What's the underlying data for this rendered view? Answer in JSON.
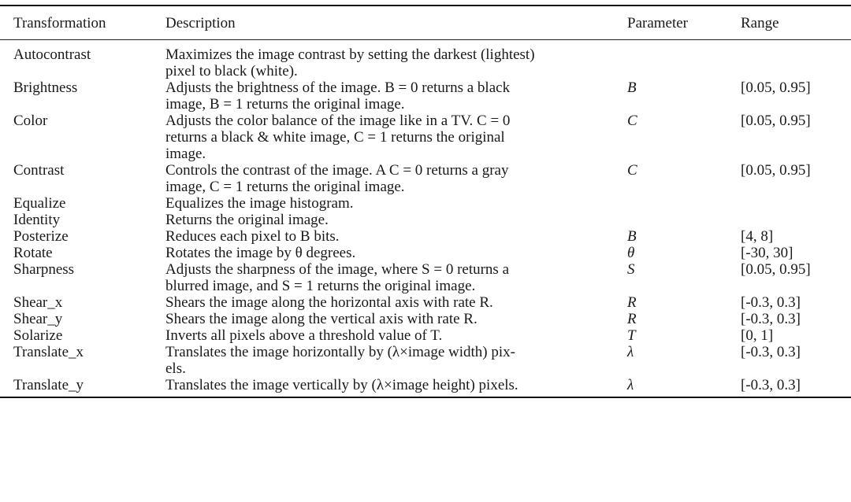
{
  "table": {
    "headers": {
      "transformation": "Transformation",
      "description": "Description",
      "parameter": "Parameter",
      "range": "Range"
    },
    "rows": [
      {
        "transformation": "Autocontrast",
        "description": "Maximizes the image contrast by setting the darkest (lightest)\npixel to black (white).",
        "parameter": "",
        "range": ""
      },
      {
        "transformation": "Brightness",
        "description": "Adjusts the brightness of the image. B = 0 returns a black\nimage, B = 1 returns the original image.",
        "parameter": "B",
        "range": "[0.05, 0.95]"
      },
      {
        "transformation": "Color",
        "description": "Adjusts the color balance of the image like in a TV. C = 0\nreturns a black & white image, C = 1 returns the original\nimage.",
        "parameter": "C",
        "range": "[0.05, 0.95]"
      },
      {
        "transformation": "Contrast",
        "description": "Controls the contrast of the image. A C = 0 returns a gray\nimage, C = 1 returns the original image.",
        "parameter": "C",
        "range": "[0.05, 0.95]"
      },
      {
        "transformation": "Equalize",
        "description": "Equalizes the image histogram.",
        "parameter": "",
        "range": ""
      },
      {
        "transformation": "Identity",
        "description": "Returns the original image.",
        "parameter": "",
        "range": ""
      },
      {
        "transformation": "Posterize",
        "description": "Reduces each pixel to B bits.",
        "parameter": "B",
        "range": "[4, 8]"
      },
      {
        "transformation": "Rotate",
        "description": "Rotates the image by θ degrees.",
        "parameter": "θ",
        "range": "[-30, 30]"
      },
      {
        "transformation": "Sharpness",
        "description": "Adjusts the sharpness of the image, where S = 0 returns a\nblurred image, and S = 1 returns the original image.",
        "parameter": "S",
        "range": "[0.05, 0.95]"
      },
      {
        "transformation": "Shear_x",
        "description": "Shears the image along the horizontal axis with rate R.",
        "parameter": "R",
        "range": "[-0.3, 0.3]"
      },
      {
        "transformation": "Shear_y",
        "description": "Shears the image along the vertical axis with rate R.",
        "parameter": "R",
        "range": "[-0.3, 0.3]"
      },
      {
        "transformation": "Solarize",
        "description": "Inverts all pixels above a threshold value of T.",
        "parameter": "T",
        "range": "[0, 1]"
      },
      {
        "transformation": "Translate_x",
        "description": "Translates the image horizontally by (λ×image width) pix-\nels.",
        "parameter": "λ",
        "range": "[-0.3, 0.3]"
      },
      {
        "transformation": "Translate_y",
        "description": "Translates the image vertically by (λ×image height) pixels.",
        "parameter": "λ",
        "range": "[-0.3, 0.3]"
      }
    ]
  }
}
